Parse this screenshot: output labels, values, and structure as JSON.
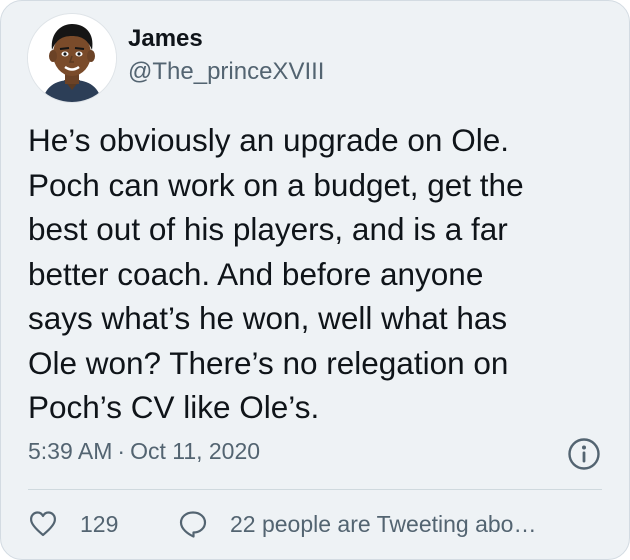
{
  "author": {
    "name": "James",
    "handle": "@The_princeXVIII",
    "avatar_icon": "cartoon-avatar-icon"
  },
  "tweet": {
    "lines": [
      "He’s obviously an upgrade on Ole.",
      "Poch can work on a budget, get the",
      "best out of his players, and is a far",
      "better coach. And before anyone",
      "says what’s he won, well what has",
      "Ole won? There’s no relegation on",
      "Poch’s CV like Ole’s."
    ],
    "time": "5:39 AM",
    "separator": "·",
    "date": "Oct 11, 2020"
  },
  "actions": {
    "likes": "129",
    "reply_text": "22 people are Tweeting abo…",
    "like_icon": "heart-icon",
    "reply_icon": "speech-bubble-icon",
    "info_icon": "info-icon"
  },
  "colors": {
    "background": "#eef2f5",
    "text": "#0f1419",
    "secondary": "#536471",
    "divider": "#cfd9de"
  }
}
